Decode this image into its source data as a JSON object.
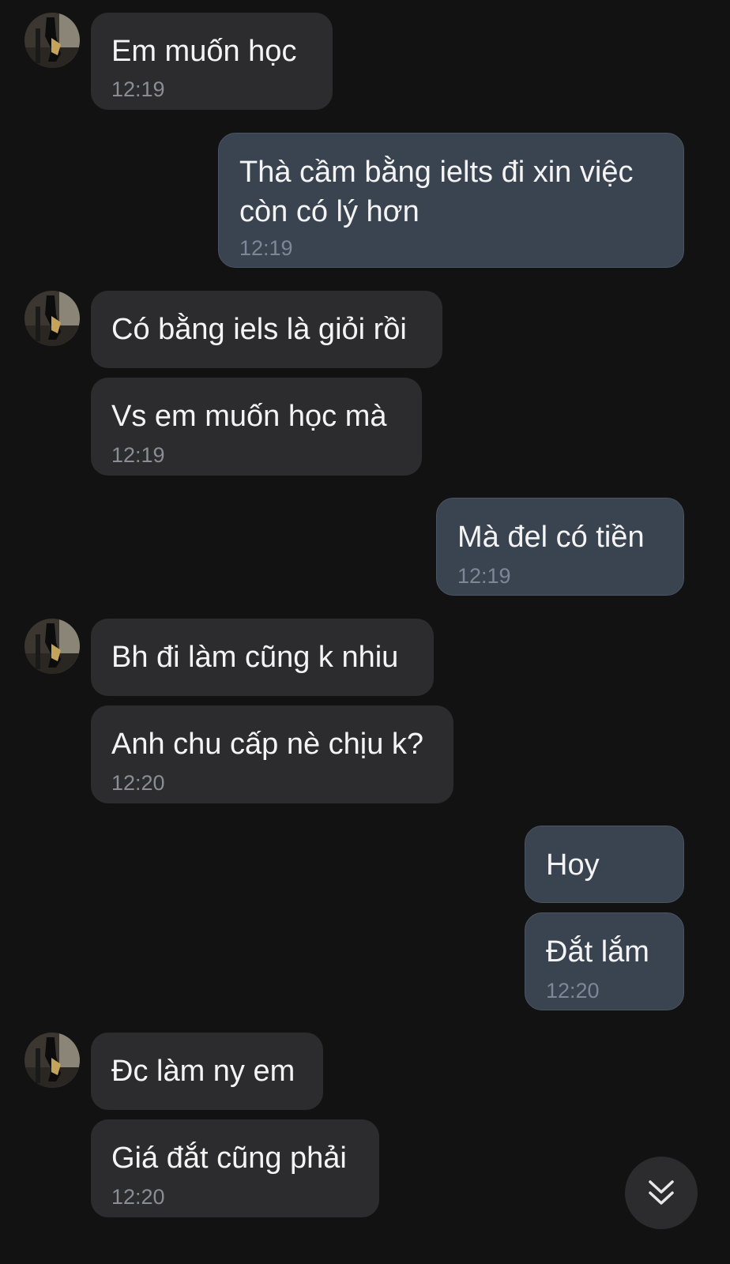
{
  "messages": [
    {
      "side": "in",
      "text": "Em muốn học",
      "time": "12:19"
    },
    {
      "side": "out",
      "text": "Thà cầm bằng ielts đi xin việc còn có lý hơn",
      "time": "12:19"
    },
    {
      "side": "in",
      "text": "Có bằng iels là giỏi rồi",
      "time": ""
    },
    {
      "side": "in",
      "text": "Vs em muốn học mà",
      "time": "12:19"
    },
    {
      "side": "out",
      "text": "Mà đel có tiền",
      "time": "12:19"
    },
    {
      "side": "in",
      "text": "Bh đi làm cũng k nhiu",
      "time": ""
    },
    {
      "side": "in",
      "text": "Anh chu cấp nè chịu k?",
      "time": "12:20"
    },
    {
      "side": "out",
      "text": "Hoy",
      "time": ""
    },
    {
      "side": "out",
      "text": "Đắt lắm",
      "time": "12:20"
    },
    {
      "side": "in",
      "text": "Đc làm ny em",
      "time": ""
    },
    {
      "side": "in",
      "text": "Giá đắt cũng phải",
      "time": "12:20"
    }
  ],
  "icons": {
    "scroll_down": "double-chevron-down-icon",
    "avatar": "contact-avatar"
  },
  "colors": {
    "background": "#121212",
    "incoming_bubble": "#2c2c2e",
    "outgoing_bubble": "#3a4350"
  }
}
